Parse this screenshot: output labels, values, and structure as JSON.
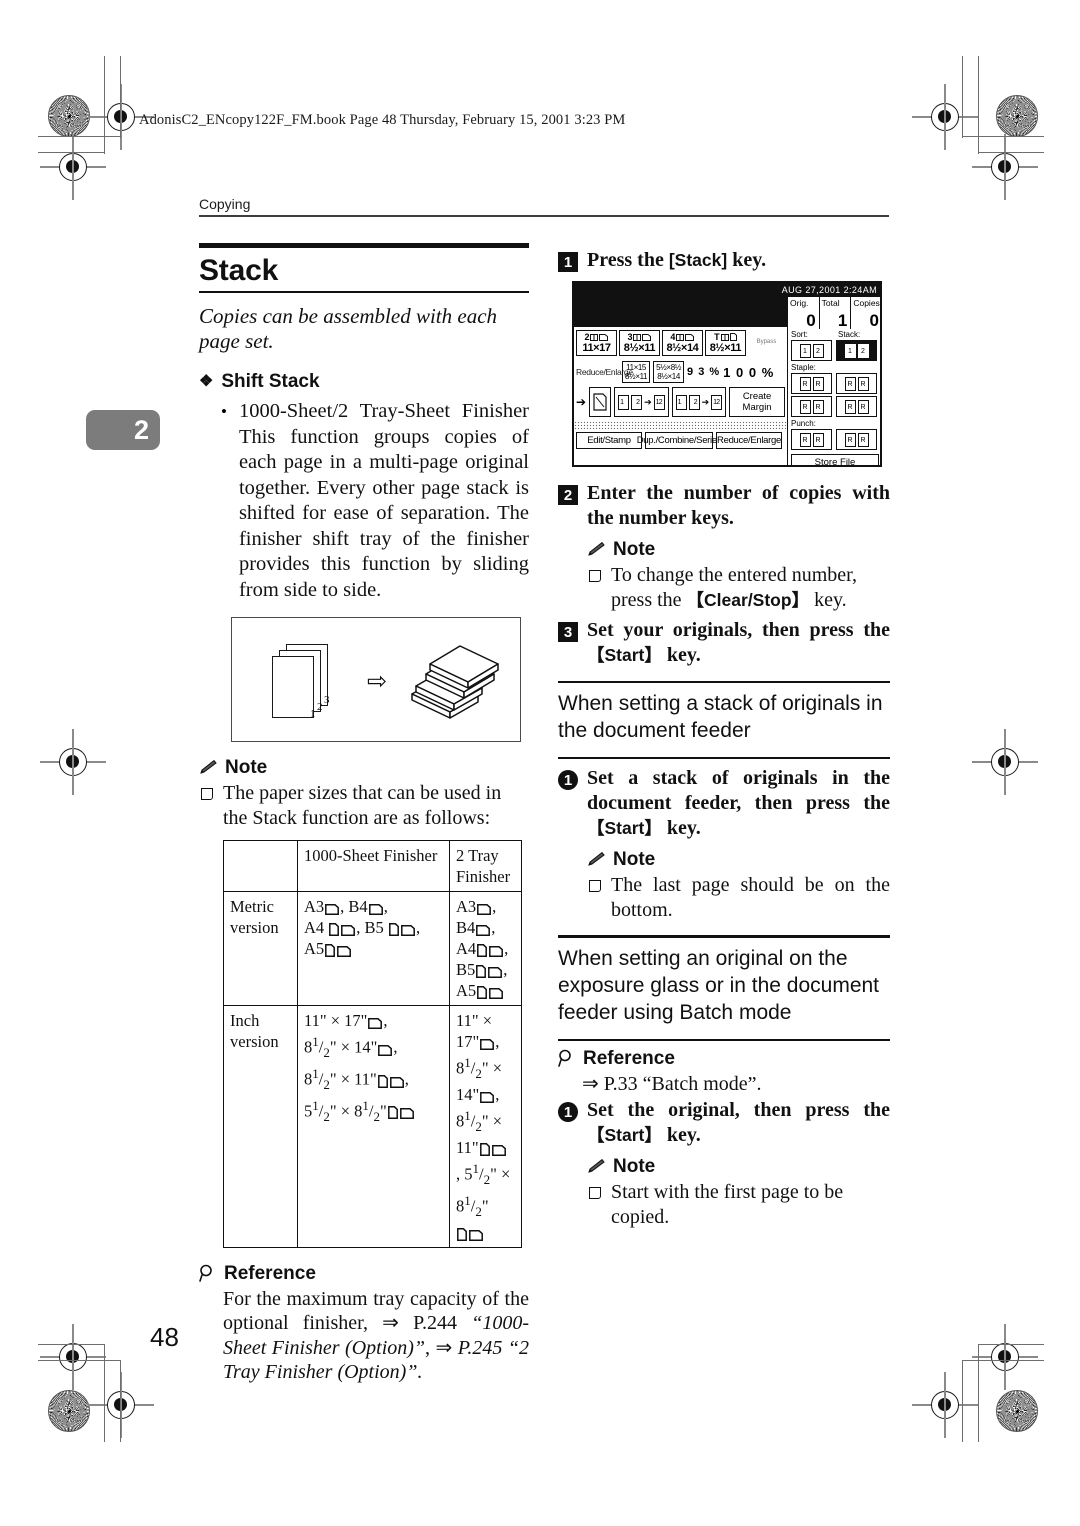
{
  "file_header": "AdonisC2_ENcopy122F_FM.book  Page 48  Thursday, February 15, 2001  3:23 PM",
  "running_head": "Copying",
  "chapter_tab": "2",
  "page_number": "48",
  "left": {
    "section_title": "Stack",
    "lead": "Copies can be assembled with each page set.",
    "shift_stack_head": "Shift Stack",
    "shift_stack_bullet": "1000-Sheet/2 Tray-Sheet Finisher This function groups copies of each page in a multi-page original together. Every other page stack is shifted for ease of separation. The finisher shift tray of the finisher provides this function by sliding from side to side.",
    "illustration": {
      "sheet_numbers": [
        "1",
        "2",
        "3"
      ],
      "arrow": "⇨"
    },
    "note_head": "Note",
    "note_item": "The paper sizes that can be used in the Stack function are as follows:",
    "table": {
      "headers": [
        "",
        "1000-Sheet Finisher",
        "2 Tray Finisher"
      ],
      "rows": [
        {
          "label": "Metric version",
          "finisher_1000": "A3[L], B4[L], A4[P][L], B5[P][L], A5[P][L]",
          "finisher_2tray": "A3[L], B4[L], A4[P][L], B5[P][L], A5[P][L]"
        },
        {
          "label": "Inch version",
          "finisher_1000": "11\" x 17\"[L], 8 1/2\" x 14\"[L], 8 1/2\" x 11\"[P][L], 5 1/2\" x 8 1/2\"[P][L]",
          "finisher_2tray": "11\" x 17\"[L], 8 1/2\" x 14\"[L], 8 1/2\" x 11\"[P][L], 5 1/2\" x 8 1/2\"[P][L]"
        }
      ]
    },
    "reference_head": "Reference",
    "reference_text": "For the maximum tray capacity of the optional finisher, ⇒ P.244 “1000-Sheet Finisher (Option)”, ⇒ P.245 “2 Tray Finisher (Option)”."
  },
  "right": {
    "step1": {
      "num": "1",
      "text_pre": "Press the ",
      "key": "[Stack]",
      "text_post": " key."
    },
    "lcd": {
      "datetime": "AUG  27,2001  2:24AM",
      "counters": [
        {
          "label": "Orig.",
          "value": "0"
        },
        {
          "label": "Total",
          "value": "1"
        },
        {
          "label": "Copies",
          "value": "0"
        }
      ],
      "trays": [
        {
          "id": "2",
          "size": "11×17"
        },
        {
          "id": "3",
          "size": "8½×11"
        },
        {
          "id": "4",
          "size": "8½×14"
        },
        {
          "id": "T",
          "size": "8½×11"
        }
      ],
      "bypass_label": "Bypass",
      "reduce_enlarge_label": "Reduce/Enlarge",
      "ratio_boxes": [
        "11×15→\n8½×11",
        "5½×8½→\n8½×14"
      ],
      "ratio_93": "9 3 %",
      "ratio_100": "1 0 0 %",
      "create_margin": "Create Margin",
      "tabs": [
        "Edit/Stamp",
        "Dup./Combine/Series",
        "Reduce/Enlarge"
      ],
      "sort_label": "Sort:",
      "stack_label": "Stack:",
      "staple_label": "Staple:",
      "punch_label": "Punch:",
      "store_file": "Store File"
    },
    "step2": {
      "num": "2",
      "text": "Enter the number of copies with the number keys."
    },
    "note2_head": "Note",
    "note2_item_pre": "To change the entered number, press the ",
    "note2_key": "【Clear/Stop】",
    "note2_item_post": " key.",
    "step3": {
      "num": "3",
      "text_pre": "Set your originals, then press the ",
      "key": "【Start】",
      "text_post": " key."
    },
    "subhead_a": "When setting a stack of originals in the document feeder",
    "stepA1": {
      "text_pre": "Set a stack of originals in the document feeder, then press the ",
      "key": "【Start】",
      "text_post": " key."
    },
    "noteA_head": "Note",
    "noteA_item": "The last page should be on the bottom.",
    "subhead_b": "When setting an original on the exposure glass or in the document feeder using Batch mode",
    "referenceB_head": "Reference",
    "referenceB_text": "⇒ P.33 “Batch mode”.",
    "stepB1": {
      "text_pre": "Set the original, then press the ",
      "key": "【Start】",
      "text_post": " key."
    },
    "noteB_head": "Note",
    "noteB_item": "Start with the first page to be copied."
  }
}
